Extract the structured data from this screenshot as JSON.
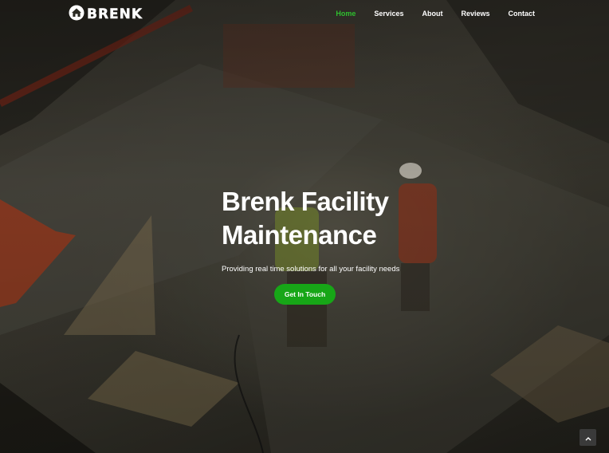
{
  "brand": {
    "name": "BRENK",
    "logo_icon": "house-icon",
    "accent_color": "#17a617"
  },
  "nav": {
    "items": [
      {
        "label": "Home",
        "active": true
      },
      {
        "label": "Services",
        "active": false
      },
      {
        "label": "About",
        "active": false
      },
      {
        "label": "Reviews",
        "active": false
      },
      {
        "label": "Contact",
        "active": false
      }
    ]
  },
  "hero": {
    "title_line1": "Brenk Facility",
    "title_line2": "Maintenance",
    "subtitle": "Providing real time solutions for all your facility needs",
    "cta_label": "Get In Touch"
  },
  "back_to_top": {
    "icon": "chevron-up-icon"
  }
}
